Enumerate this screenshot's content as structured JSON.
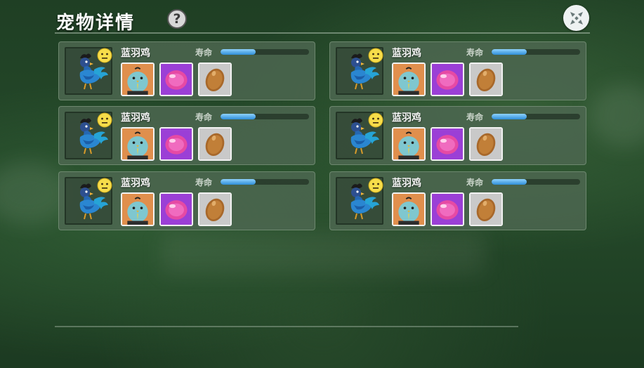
{
  "header": {
    "title": "宠物详情",
    "help_label": "?"
  },
  "icons": {
    "help": "question-mark-icon",
    "close": "close-x-icon",
    "mood": "neutral-face-icon",
    "pet": "blue-rooster-icon",
    "item1": "blue-bird-card-icon",
    "item2": "pink-gem-icon",
    "item3": "egg-icon"
  },
  "colors": {
    "life_bar_fill": "#2f8ed8",
    "card_bg": "#4e6852",
    "item1_bg": "#e08f4d",
    "item2_bg": "#9b3fd6",
    "item3_bg": "#c9c9c9"
  },
  "pets": [
    {
      "name": "蓝羽鸡",
      "life_label": "寿命",
      "life": 0.4
    },
    {
      "name": "蓝羽鸡",
      "life_label": "寿命",
      "life": 0.4
    },
    {
      "name": "蓝羽鸡",
      "life_label": "寿命",
      "life": 0.4
    },
    {
      "name": "蓝羽鸡",
      "life_label": "寿命",
      "life": 0.4
    },
    {
      "name": "蓝羽鸡",
      "life_label": "寿命",
      "life": 0.4
    },
    {
      "name": "蓝羽鸡",
      "life_label": "寿命",
      "life": 0.4
    }
  ]
}
